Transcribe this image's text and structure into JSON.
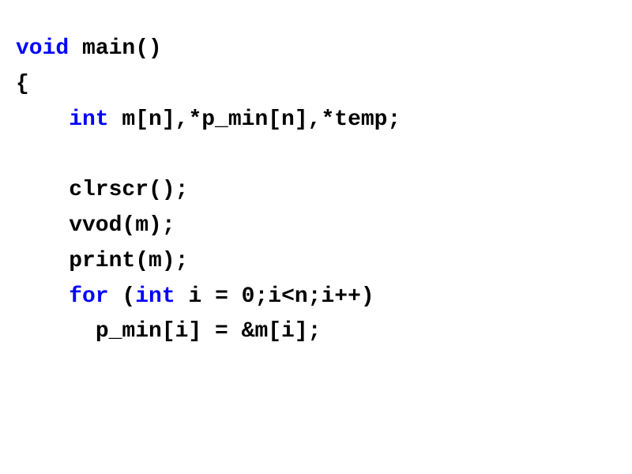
{
  "code": {
    "line1_kw": "void",
    "line1_rest": " main()",
    "line2": "{",
    "line3_kw": "int",
    "line3_rest": " m[n],*p_min[n],*temp;",
    "line5": "clrscr();",
    "line6": "vvod(m);",
    "line7": "print(m);",
    "line8_kw_for": "for",
    "line8_mid": " (",
    "line8_kw_int": "int",
    "line8_rest": " i = 0;i<n;i++)",
    "line9": "p_min[i] = &m[i];"
  }
}
